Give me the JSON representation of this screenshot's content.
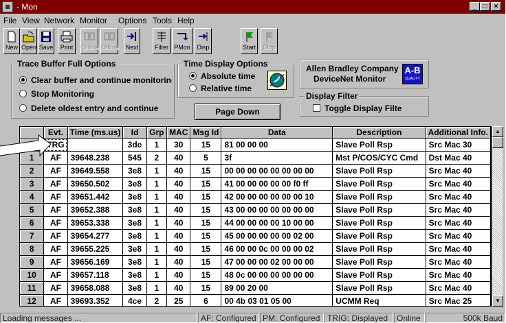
{
  "window": {
    "title": "- Mon"
  },
  "menu": [
    "File",
    "View",
    "Network",
    "Monitor",
    "Options",
    "Tools",
    "Help"
  ],
  "toolbar": [
    {
      "label": "New",
      "icon": "new-file-icon",
      "enabled": true
    },
    {
      "label": "Open",
      "icon": "open-folder-icon",
      "enabled": true
    },
    {
      "label": "Save",
      "icon": "save-disk-icon",
      "enabled": true
    },
    {
      "label": "Print",
      "icon": "printer-icon",
      "enabled": true
    },
    {
      "label": "Online",
      "icon": "online-icon",
      "enabled": false
    },
    {
      "label": "Offline",
      "icon": "offline-icon",
      "enabled": false
    },
    {
      "label": "Next",
      "icon": "next-arrow-icon",
      "enabled": true
    },
    {
      "label": "Filter",
      "icon": "filter-icon",
      "enabled": true
    },
    {
      "label": "PMon",
      "icon": "pmon-icon",
      "enabled": true
    },
    {
      "label": "Disp",
      "icon": "display-icon",
      "enabled": true
    },
    {
      "label": "Start",
      "icon": "start-flag-icon",
      "enabled": true
    },
    {
      "label": "Stop",
      "icon": "stop-flag-icon",
      "enabled": false
    }
  ],
  "trace_buffer": {
    "title": "Trace Buffer Full Options",
    "options": [
      "Clear buffer and continue monitoring",
      "Stop Monitoring",
      "Delete oldest entry and continue"
    ],
    "selected": 0
  },
  "time_display": {
    "title": "Time Display Options",
    "options": [
      "Absolute time",
      "Relative time"
    ],
    "selected": 0
  },
  "page_down_label": "Page Down",
  "company": {
    "line1": "Allen Bradley Company",
    "line2": "DeviceNet Monitor",
    "logo": "A-B",
    "logo_sub": "QUALITY"
  },
  "display_filter": {
    "title": "Display Filter",
    "option": "Toggle Display Filte",
    "checked": false
  },
  "table": {
    "columns": [
      "",
      "Evt.",
      "Time (ms.us)",
      "Id",
      "Grp",
      "MAC",
      "Msg Id",
      "Data",
      "Description",
      "Additional Info."
    ],
    "rows": [
      [
        "",
        "TRG",
        "",
        "3de",
        "1",
        "30",
        "15",
        "81 00 00 00",
        "Slave Poll Rsp",
        "Src Mac 30"
      ],
      [
        "1",
        "AF",
        "39648.238",
        "545",
        "2",
        "40",
        "5",
        "3f",
        "Mst P/COS/CYC Cmd",
        "Dst Mac 40"
      ],
      [
        "2",
        "AF",
        "39649.558",
        "3e8",
        "1",
        "40",
        "15",
        "00 00 00 00 00 00 00 00",
        "Slave Poll Rsp",
        "Src Mac 40"
      ],
      [
        "3",
        "AF",
        "39650.502",
        "3e8",
        "1",
        "40",
        "15",
        "41 00 00 00 00 00 f0 ff",
        "Slave Poll Rsp",
        "Src Mac 40"
      ],
      [
        "4",
        "AF",
        "39651.442",
        "3e8",
        "1",
        "40",
        "15",
        "42 00 00 00 00 00 00 10",
        "Slave Poll Rsp",
        "Src Mac 40"
      ],
      [
        "5",
        "AF",
        "39652.388",
        "3e8",
        "1",
        "40",
        "15",
        "43 00 00 00 00 00 00 00",
        "Slave Poll Rsp",
        "Src Mac 40"
      ],
      [
        "6",
        "AF",
        "39653.338",
        "3e8",
        "1",
        "40",
        "15",
        "44 00 00 00 00 10 00 00",
        "Slave Poll Rsp",
        "Src Mac 40"
      ],
      [
        "7",
        "AF",
        "39654.277",
        "3e8",
        "1",
        "40",
        "15",
        "45 00 00 00 00 00 02 00",
        "Slave Poll Rsp",
        "Src Mac 40"
      ],
      [
        "8",
        "AF",
        "39655.225",
        "3e8",
        "1",
        "40",
        "15",
        "46 00 00 0c 00 00 00 02",
        "Slave Poll Rsp",
        "Src Mac 40"
      ],
      [
        "9",
        "AF",
        "39656.169",
        "3e8",
        "1",
        "40",
        "15",
        "47 00 00 00 02 00 00 00",
        "Slave Poll Rsp",
        "Src Mac 40"
      ],
      [
        "10",
        "AF",
        "39657.118",
        "3e8",
        "1",
        "40",
        "15",
        "48 0c 00 00 00 00 00 00",
        "Slave Poll Rsp",
        "Src Mac 40"
      ],
      [
        "11",
        "AF",
        "39658.088",
        "3e8",
        "1",
        "40",
        "15",
        "89 00 20 00",
        "Slave Poll Rsp",
        "Src Mac 40"
      ],
      [
        "12",
        "AF",
        "39693.352",
        "4ce",
        "2",
        "25",
        "6",
        "00 4b 03 01 05 00",
        "UCMM Req",
        "Src Mac 25"
      ]
    ]
  },
  "status": [
    "Loading messages ...",
    "AF: Configured",
    "PM: Configured",
    "TRIG: Displayed",
    "Online",
    "500k Baud"
  ],
  "colors": {
    "titlebar": "#800000",
    "face": "#c0c0c0",
    "logo": "#1515c8"
  }
}
